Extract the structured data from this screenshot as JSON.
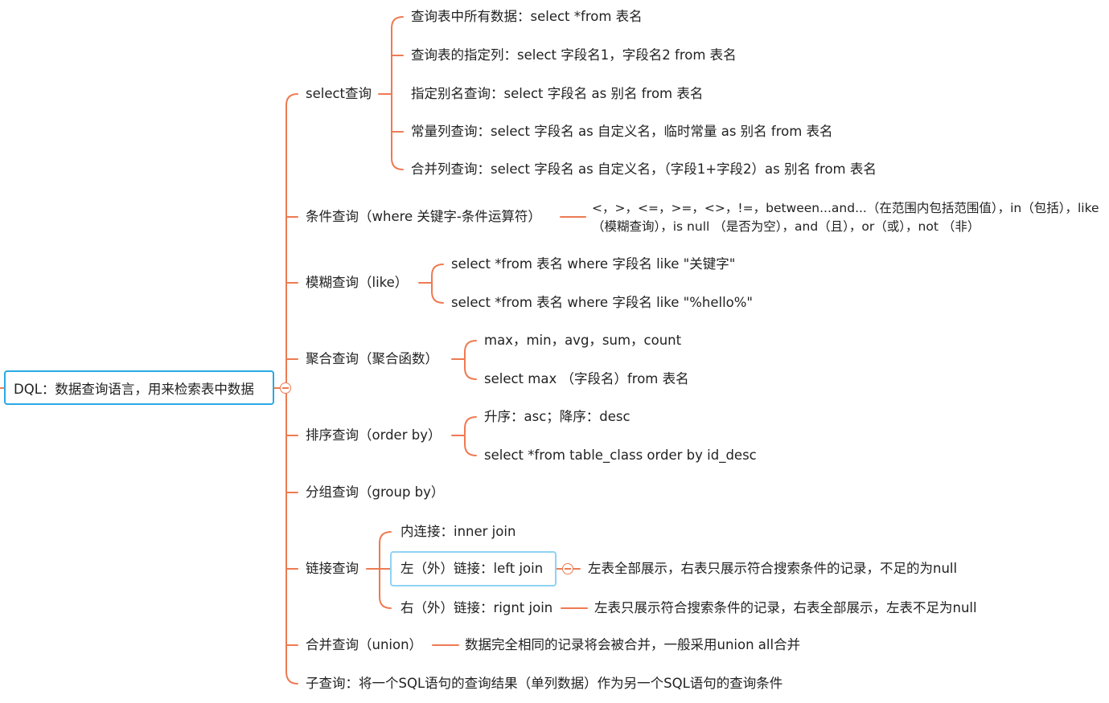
{
  "root": {
    "label": "DQL：数据查询语言，用来检索表中数据"
  },
  "branches": {
    "select": {
      "label": "select查询",
      "children": [
        "查询表中所有数据：select *from 表名",
        "查询表的指定列：select 字段名1，字段名2 from 表名",
        "指定别名查询：select 字段名 as 别名 from 表名",
        "常量列查询：select 字段名 as 自定义名，临时常量 as 别名 from 表名",
        "合并列查询：select 字段名 as 自定义名，（字段1+字段2）as 别名 from 表名"
      ]
    },
    "condition": {
      "label": "条件查询（where 关键字-条件运算符）",
      "detail": "<，>，<=，>=，<>，!=，between...and...（在范围内包括范围值），in（包括），like（模糊查询），is null （是否为空），and（且），or（或），not （非）"
    },
    "like": {
      "label": "模糊查询（like）",
      "children": [
        "select *from 表名 where 字段名 like \"关键字\"",
        "select *from 表名 where 字段名 like \"%hello%\""
      ]
    },
    "aggregate": {
      "label": "聚合查询（聚合函数）",
      "children": [
        "max，min，avg，sum，count",
        "select max （字段名）from 表名"
      ]
    },
    "order": {
      "label": "排序查询（order by）",
      "children": [
        "升序：asc；降序：desc",
        "select *from table_class order by id_desc"
      ]
    },
    "group": {
      "label": "分组查询（group by）"
    },
    "join": {
      "label": "链接查询",
      "inner": "内连接：inner join",
      "left": "左（外）链接：left join",
      "left_detail": "左表全部展示，右表只展示符合搜索条件的记录，不足的为null",
      "right": "右（外）链接：rignt join",
      "right_detail": "左表只展示符合搜索条件的记录，右表全部展示，左表不足为null"
    },
    "union": {
      "label": "合并查询（union）",
      "detail": "数据完全相同的记录将会被合并，一般采用union all合并"
    },
    "subquery": {
      "label": "子查询：将一个SQL语句的查询结果（单列数据）作为另一个SQL语句的查询条件"
    }
  },
  "colors": {
    "line": "#ee7a52",
    "root_border": "#29a8e6",
    "selected_border": "#8fd3f4"
  }
}
